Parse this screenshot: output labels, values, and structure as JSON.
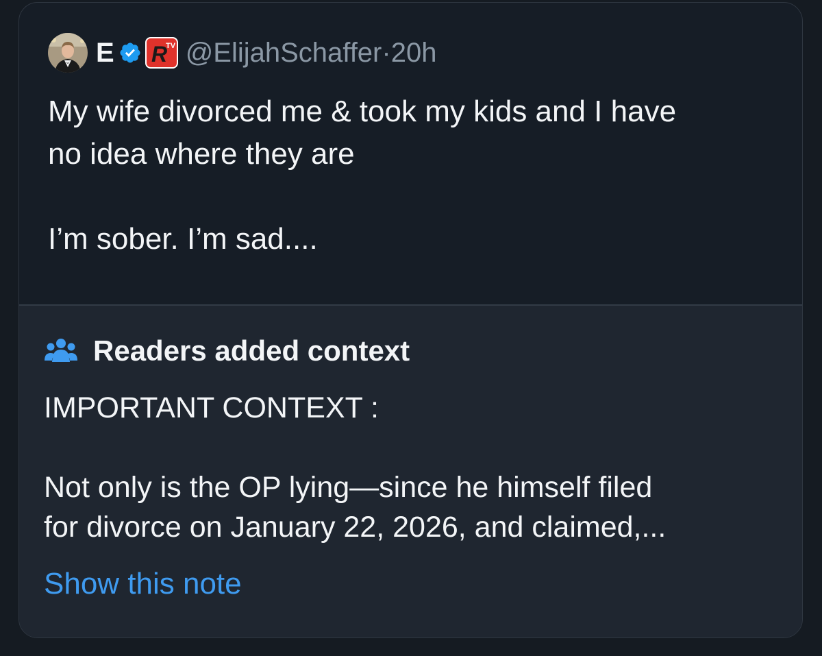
{
  "tweet": {
    "display_name": "E",
    "handle": "@ElijahSchaffer",
    "separator": "·",
    "time": "20h",
    "text": "My wife divorced me & took my kids and I have\nno idea where they are\n\nI’m sober. I’m sad....",
    "icons": {
      "verified": "verified-badge-icon",
      "affiliate": "rtv-affiliate-icon",
      "avatar": "profile-avatar"
    }
  },
  "community_note": {
    "title": "Readers added context",
    "text": "IMPORTANT CONTEXT :\n\nNot only is the OP lying—since he himself filed\nfor divorce on January 22, 2026, and claimed,...",
    "link_label": "Show this note",
    "icon": "people-icon"
  },
  "colors": {
    "background": "#151b22",
    "card": "#161d26",
    "note_background": "#1f2630",
    "text": "#f3f5f7",
    "muted": "#8b98a5",
    "accent": "#3f9bf0",
    "verified": "#1d9bf0",
    "affiliate_badge": "#e0322b"
  }
}
